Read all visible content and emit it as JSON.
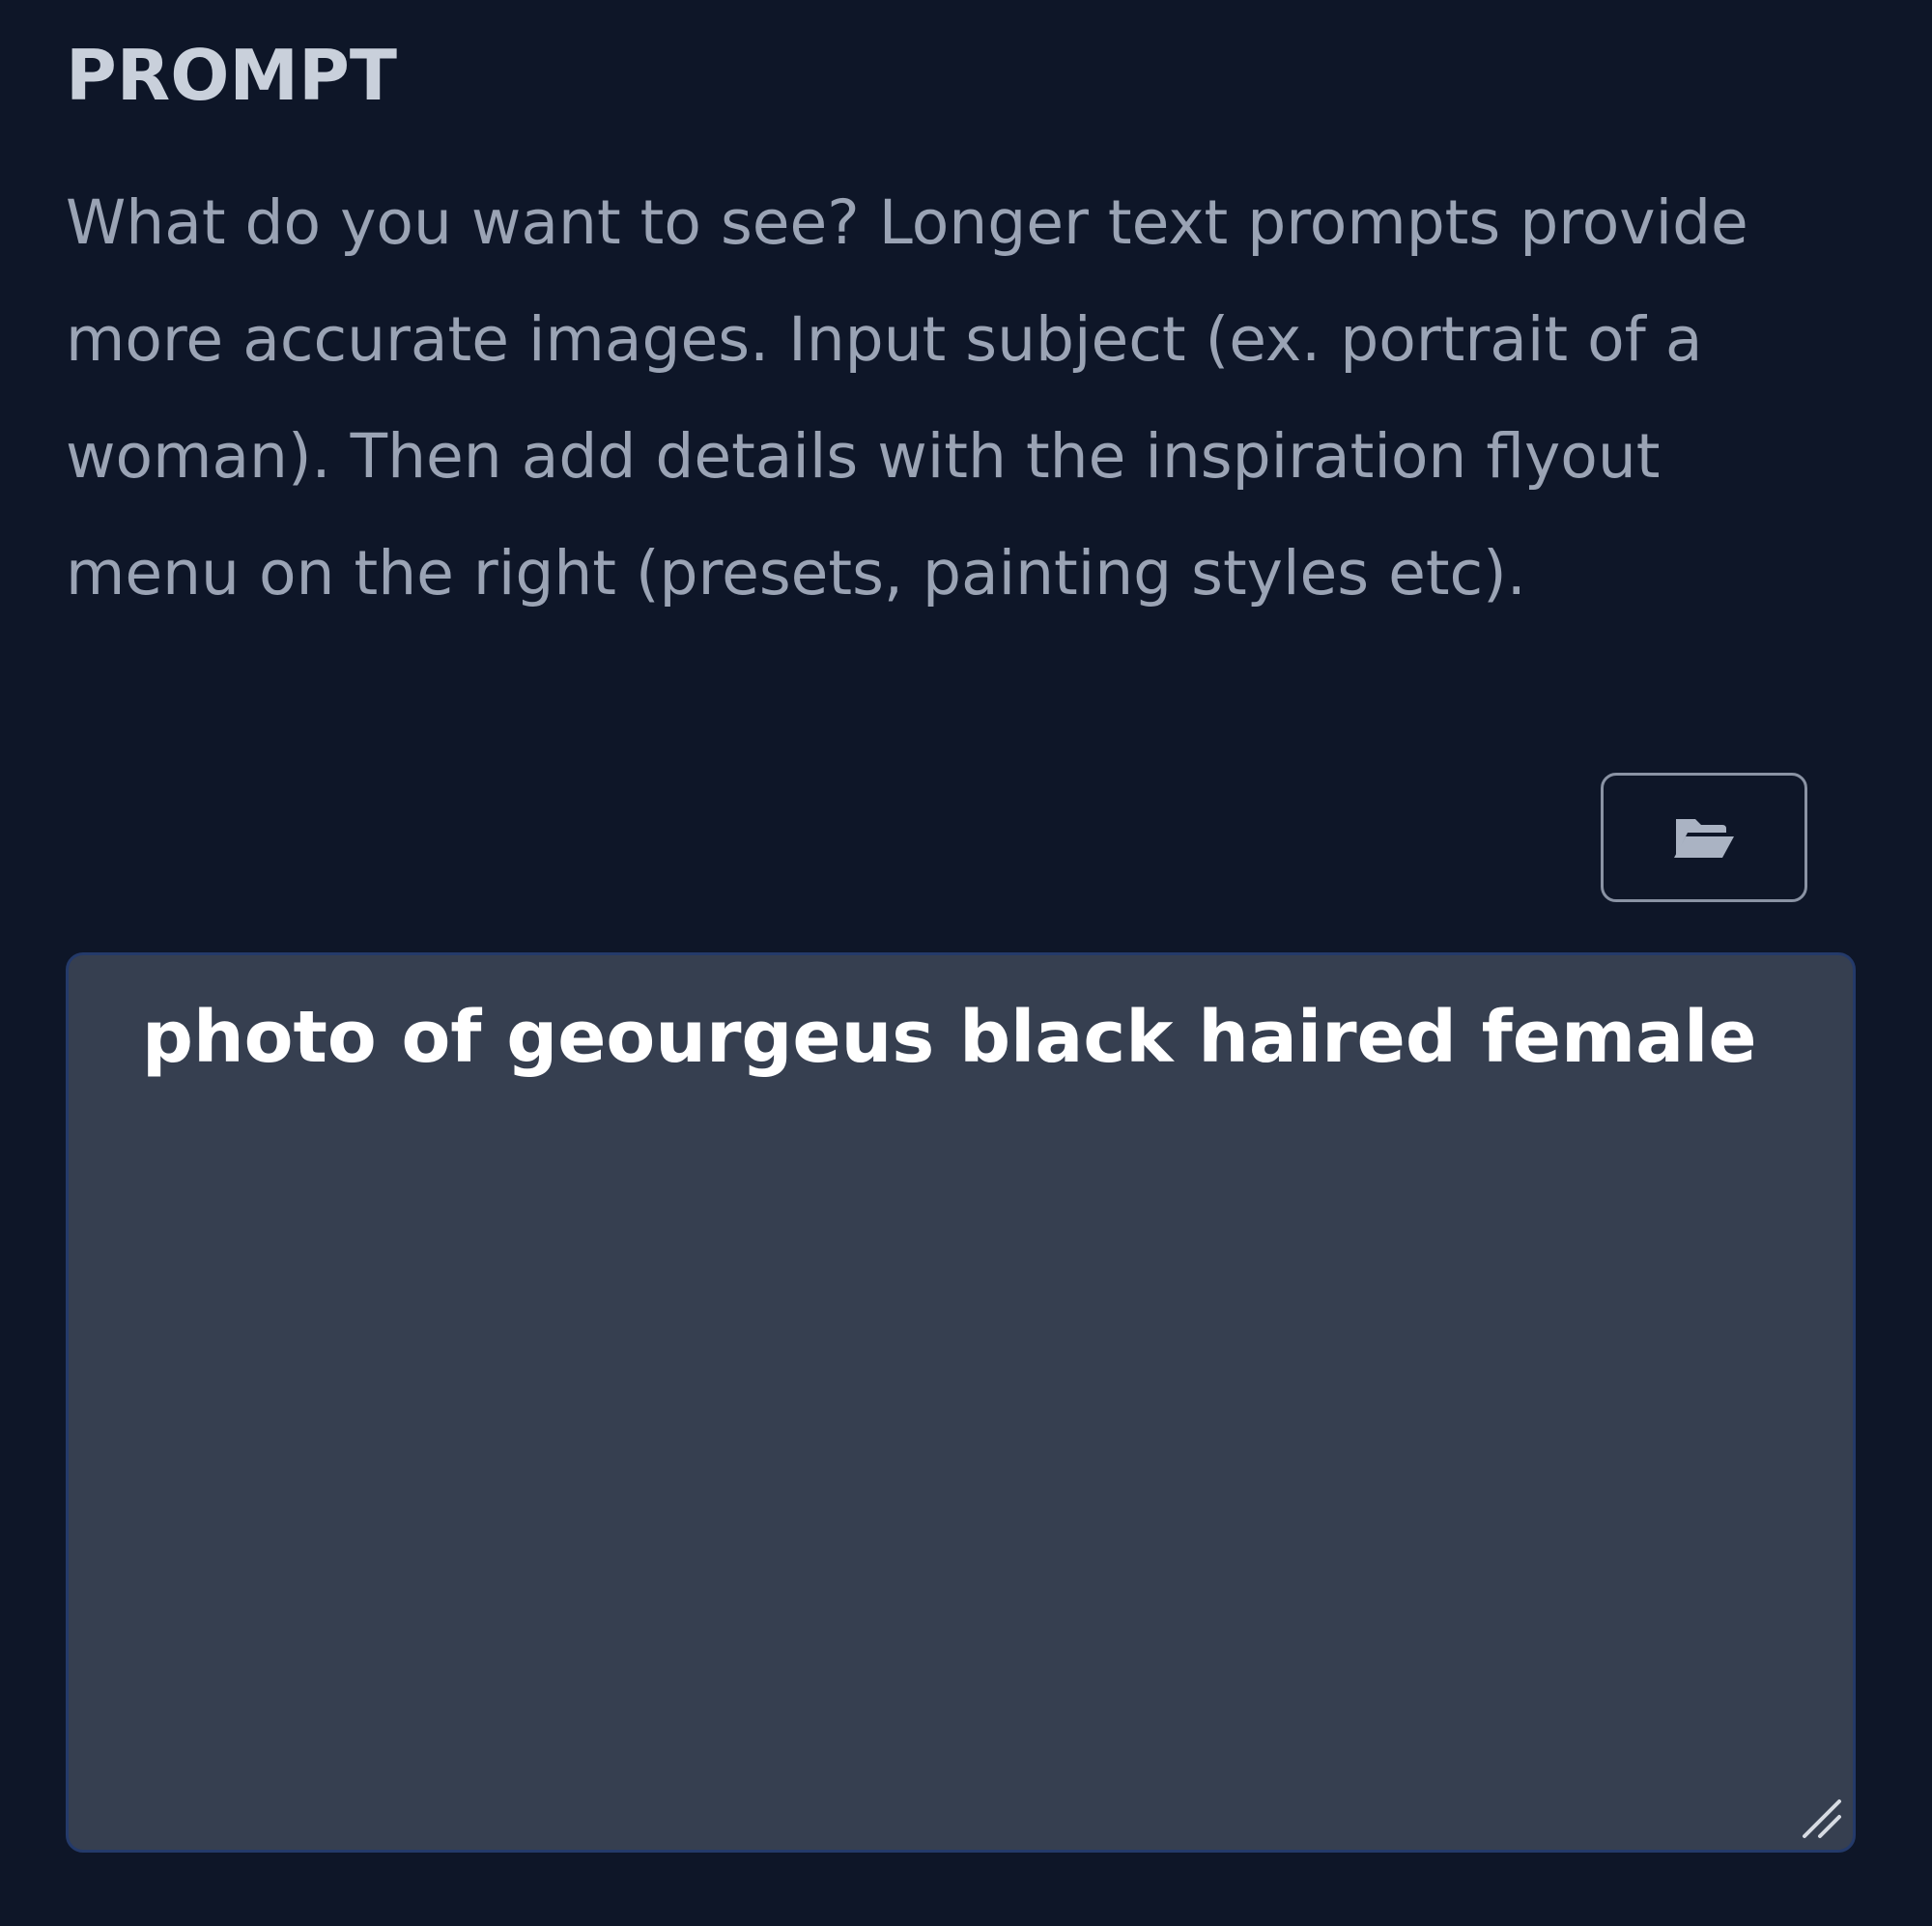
{
  "prompt_section": {
    "title": "PROMPT",
    "description": "What do you want to see? Longer text prompts provide more accurate images. Input subject (ex. portrait of a woman). Then add details with the inspiration flyout menu on the right (presets, painting styles etc).",
    "open_button_icon": "folder-open-icon",
    "input_value": "photo of geourgeus black haired female",
    "resize_icon": "resize-grip-icon"
  },
  "colors": {
    "background": "#0e1628",
    "title": "#c9d0db",
    "description": "#9aa3b4",
    "input_background": "#363f50",
    "input_border": "#243a6a",
    "input_text": "#ffffff",
    "button_border": "#8a93a4"
  }
}
